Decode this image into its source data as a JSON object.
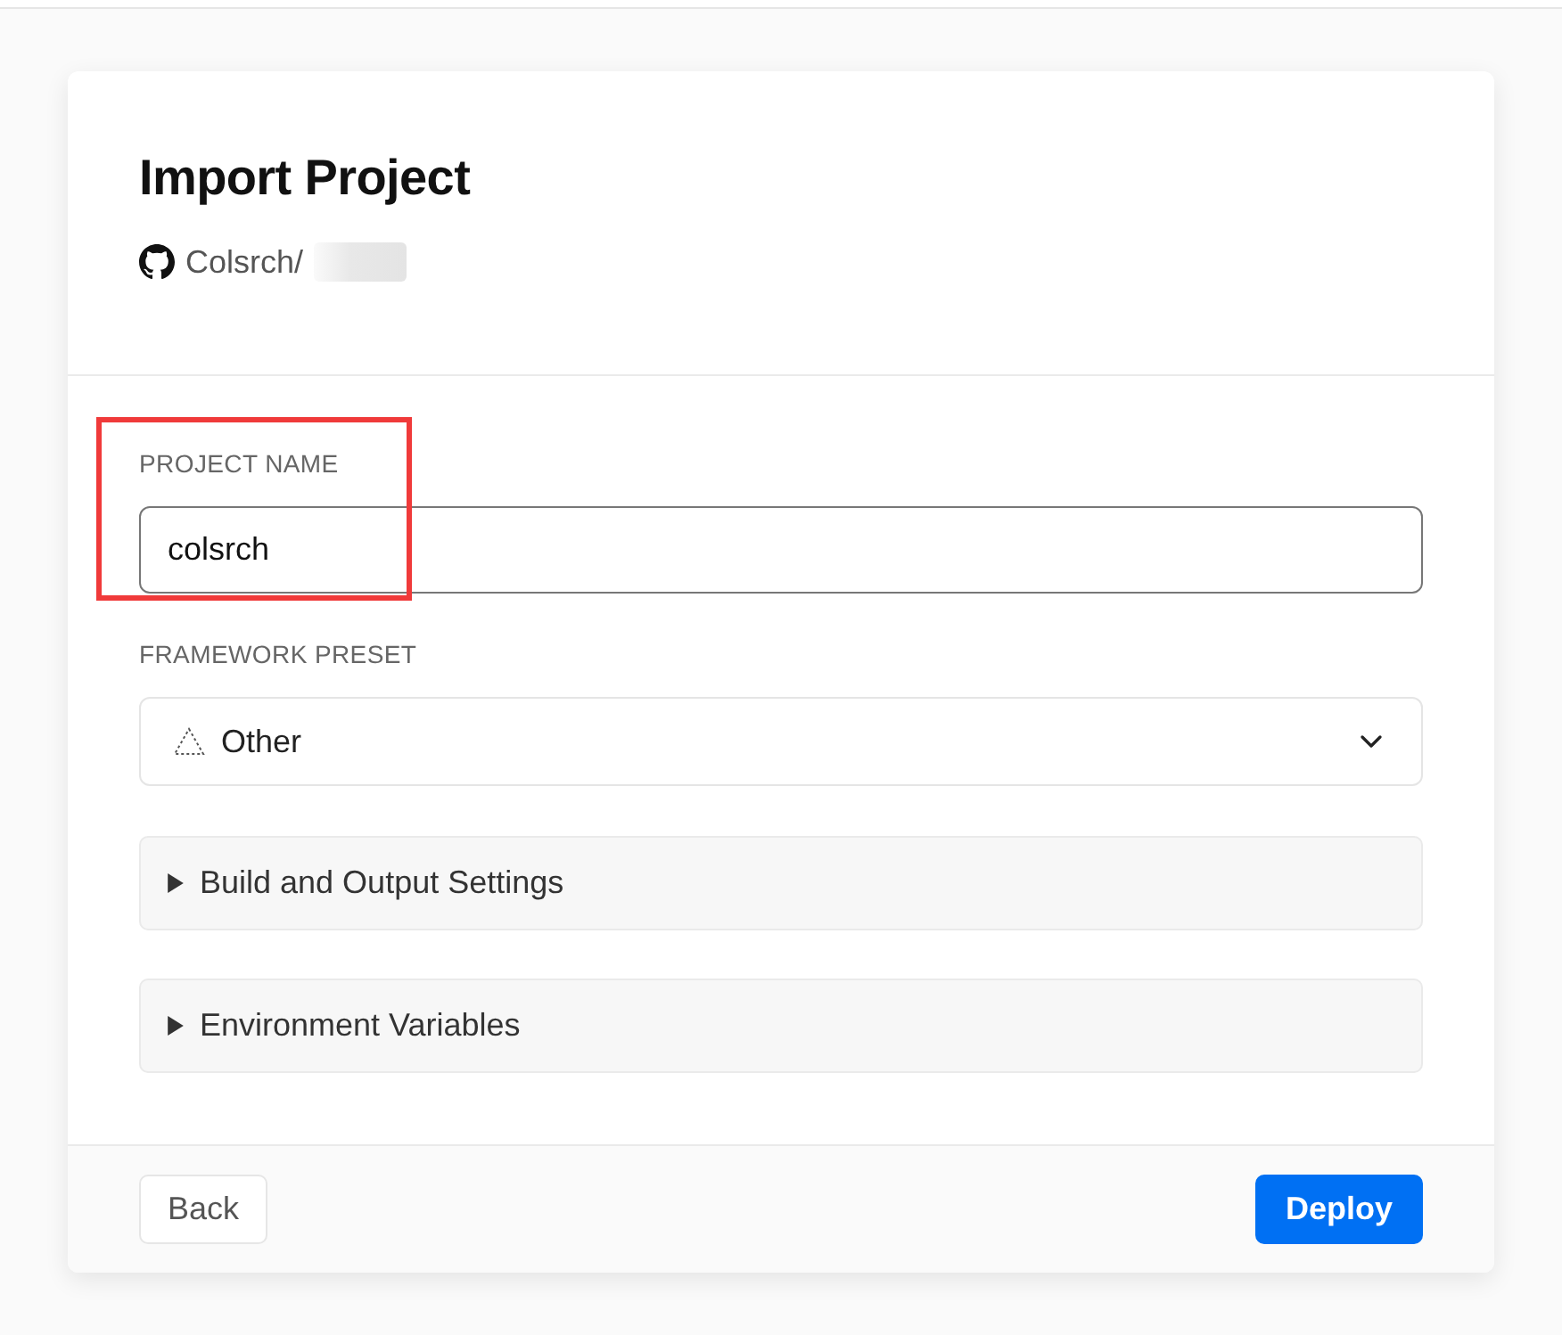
{
  "header": {
    "title": "Import Project",
    "repo": {
      "owner": "Colsrch/",
      "name_redacted": true
    }
  },
  "fields": [
    {
      "kind": "text",
      "label": "PROJECT NAME",
      "value": "colsrch",
      "highlighted": true
    },
    {
      "kind": "select",
      "label": "FRAMEWORK PRESET",
      "value": "Other",
      "expanded": false
    }
  ],
  "sections": [
    {
      "label": "Build and Output Settings",
      "expanded": false
    },
    {
      "label": "Environment Variables",
      "expanded": false
    }
  ],
  "footer": {
    "buttons": [
      {
        "label": "Back",
        "kind": "secondary"
      },
      {
        "label": "Deploy",
        "kind": "primary"
      }
    ]
  }
}
